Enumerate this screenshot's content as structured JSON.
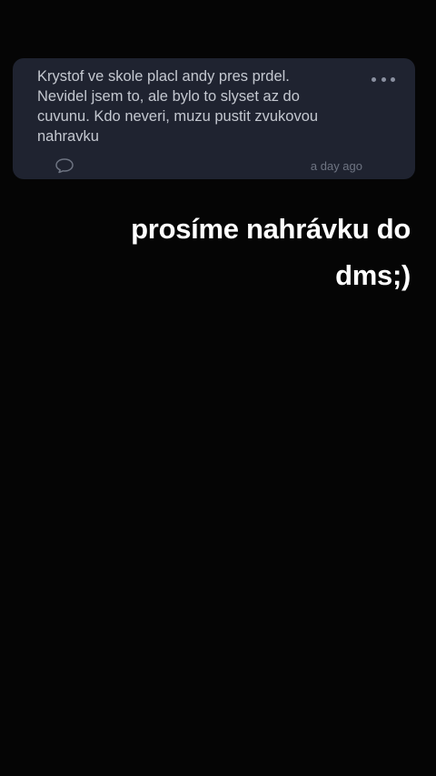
{
  "comment_card": {
    "text": "Krystof ve skole placl andy pres prdel.\nNevidel jsem to, ale bylo to slyset az do\ncuvunu. Kdo neveri, muzu pustit zvukovou\nnahravku",
    "timestamp": "a day ago",
    "more_icon": "more-horizontal-icon",
    "comment_icon": "speech-bubble-icon",
    "background_color": "#1f2330"
  },
  "overlay": {
    "line1": "prosíme nahrávku do",
    "line2": "dms;)",
    "color": "#ffffff"
  }
}
